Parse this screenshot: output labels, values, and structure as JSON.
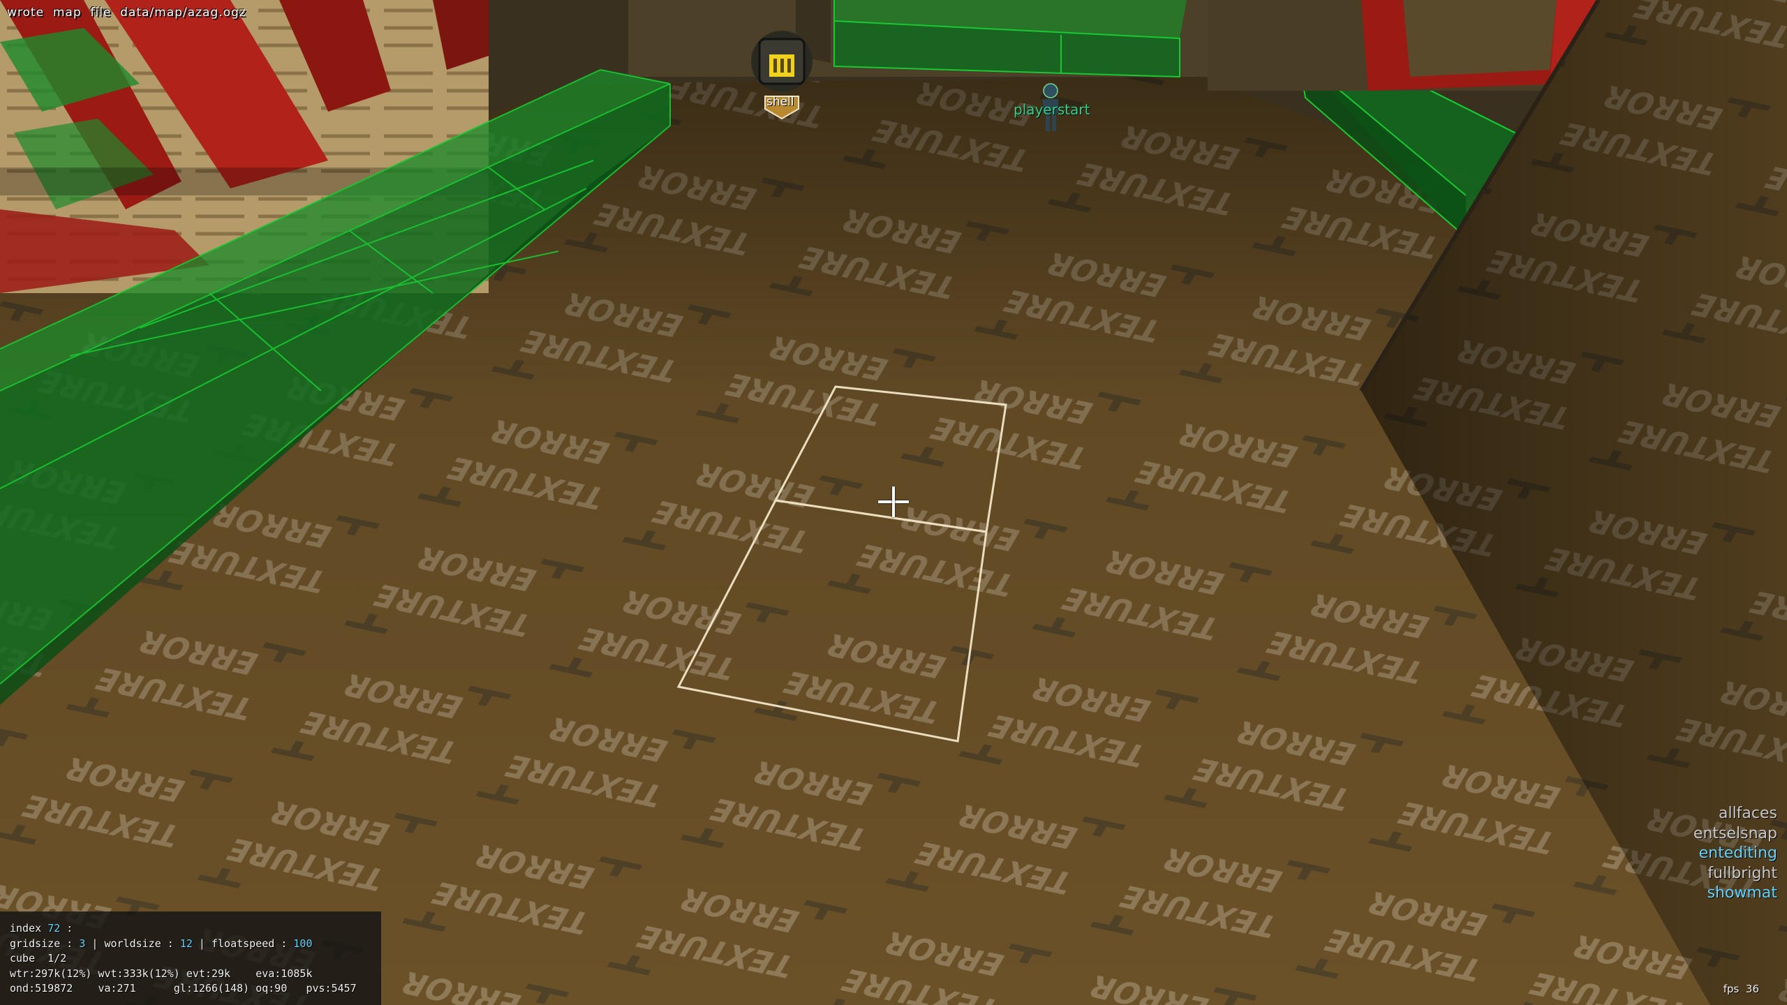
{
  "console": {
    "message": "wrote  map  file  data/map/azag.ogz"
  },
  "entities": {
    "pickup_label": "shell",
    "playerstart_label": "playerstart"
  },
  "floor_texture": {
    "word_top": "TEXTURE",
    "word_bottom": "ERROR"
  },
  "toggles": [
    {
      "label": "allfaces",
      "active": false
    },
    {
      "label": "entselsnap",
      "active": false
    },
    {
      "label": "entediting",
      "active": true
    },
    {
      "label": "fullbright",
      "active": false
    },
    {
      "label": "showmat",
      "active": true
    }
  ],
  "stats": {
    "index_label": "index",
    "index_value": "72",
    "index_sep": " :",
    "gridsize_label": "gridsize",
    "gridsize_value": "3",
    "worldsize_label": "worldsize",
    "worldsize_value": "12",
    "floatspeed_label": "floatspeed",
    "floatspeed_value": "100",
    "cube": "cube  1/2",
    "wtr": "wtr:297k(12%)",
    "wvt": "wvt:333k(12%)",
    "evt": "evt:29k",
    "eva": "eva:1085k",
    "ond": "ond:519872",
    "va": "va:271",
    "gl": "gl:1266(148)",
    "oq": "oq:90",
    "pvs": "pvs:5457"
  },
  "fps": {
    "label": "fps",
    "value": "36"
  },
  "colors": {
    "floor": "#6b5128",
    "floor_text": "#8f7a58",
    "wireframe_green": "#19c832",
    "material_green": "#0f6b1e",
    "red_wall": "#9b1a14",
    "highlight_value": "#5fd3ff",
    "selection_outline": "#f2e6c8"
  }
}
